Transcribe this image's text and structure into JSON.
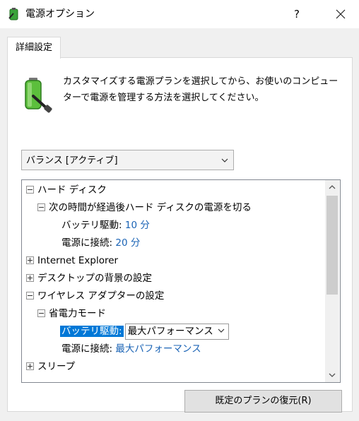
{
  "window": {
    "title": "電源オプション",
    "help_label": "?"
  },
  "tab": {
    "label": "詳細設定"
  },
  "description": "カスタマイズする電源プランを選択してから、お使いのコンピューターで電源を管理する方法を選択してください。",
  "plan_select": {
    "value": "バランス [アクティブ]"
  },
  "tree": {
    "hard_disk": {
      "label": "ハード ディスク",
      "sub_label": "次の時間が経過後ハード ディスクの電源を切る",
      "battery_label": "バッテリ駆動:",
      "battery_value": "10 分",
      "plugged_label": "電源に接続:",
      "plugged_value": "20 分"
    },
    "internet_explorer": "Internet Explorer",
    "desktop_background": "デスクトップの背景の設定",
    "wireless": {
      "label": "ワイヤレス アダプターの設定",
      "sub_label": "省電力モード",
      "battery_label": "バッテリ駆動:",
      "battery_value": "最大パフォーマンス",
      "plugged_label": "電源に接続:",
      "plugged_value": "最大パフォーマンス"
    },
    "sleep": "スリープ"
  },
  "restore_button": "既定のプランの復元(R)"
}
